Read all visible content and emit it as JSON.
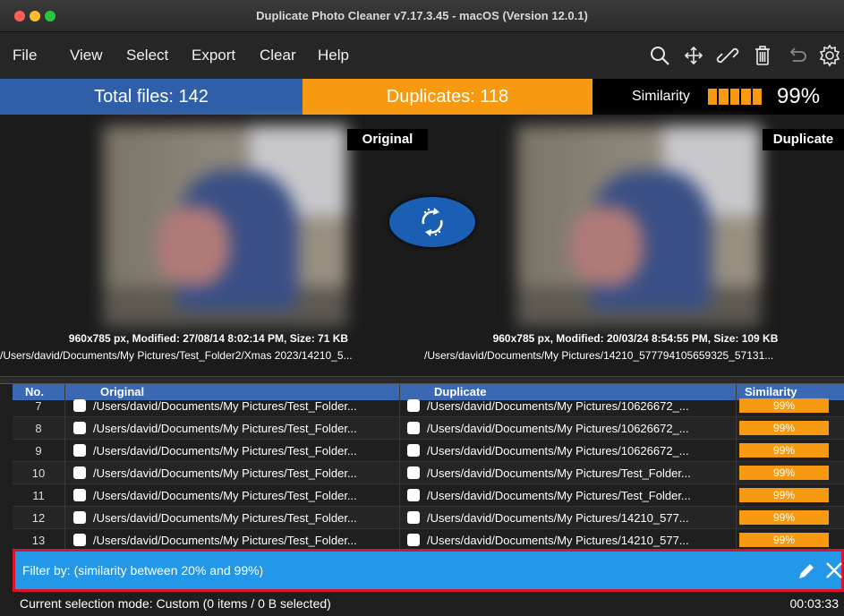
{
  "window": {
    "title": "Duplicate Photo Cleaner v7.17.3.45 - macOS (Version 12.0.1)"
  },
  "menu": {
    "items": [
      "File",
      "View",
      "Select",
      "Export",
      "Clear",
      "Help"
    ]
  },
  "toolbar": {
    "icons": [
      "search-icon",
      "move-icon",
      "link-icon",
      "trash-icon",
      "undo-icon",
      "gear-icon"
    ]
  },
  "stats": {
    "total_files": "Total files: 142",
    "duplicates": "Duplicates: 118",
    "similarity_label": "Similarity",
    "similarity_value": "99%",
    "similarity_bar_fraction": 1.0
  },
  "preview": {
    "original_tag": "Original",
    "duplicate_tag": "Duplicate",
    "original_meta": "960x785 px, Modified: 27/08/14 8:02:14 PM, Size: 71 KB",
    "duplicate_meta": "960x785 px, Modified: 20/03/24 8:54:55 PM, Size: 109 KB",
    "original_path": "/Users/david/Documents/My Pictures/Test_Folder2/Xmas 2023/14210_5...",
    "duplicate_path": "/Users/david/Documents/My Pictures/14210_577794105659325_57131..."
  },
  "table": {
    "headers": {
      "no": "No.",
      "original": "Original",
      "duplicate": "Duplicate",
      "similarity": "Similarity"
    },
    "rows": [
      {
        "no": "7",
        "original": "/Users/david/Documents/My Pictures/Test_Folder...",
        "duplicate": "/Users/david/Documents/My Pictures/10626672_...",
        "similarity": "99%"
      },
      {
        "no": "8",
        "original": "/Users/david/Documents/My Pictures/Test_Folder...",
        "duplicate": "/Users/david/Documents/My Pictures/10626672_...",
        "similarity": "99%"
      },
      {
        "no": "9",
        "original": "/Users/david/Documents/My Pictures/Test_Folder...",
        "duplicate": "/Users/david/Documents/My Pictures/10626672_...",
        "similarity": "99%"
      },
      {
        "no": "10",
        "original": "/Users/david/Documents/My Pictures/Test_Folder...",
        "duplicate": "/Users/david/Documents/My Pictures/Test_Folder...",
        "similarity": "99%"
      },
      {
        "no": "11",
        "original": "/Users/david/Documents/My Pictures/Test_Folder...",
        "duplicate": "/Users/david/Documents/My Pictures/Test_Folder...",
        "similarity": "99%"
      },
      {
        "no": "12",
        "original": "/Users/david/Documents/My Pictures/Test_Folder...",
        "duplicate": "/Users/david/Documents/My Pictures/14210_577...",
        "similarity": "99%"
      },
      {
        "no": "13",
        "original": "/Users/david/Documents/My Pictures/Test_Folder...",
        "duplicate": "/Users/david/Documents/My Pictures/14210_577...",
        "similarity": "99%"
      }
    ]
  },
  "filter": {
    "text": "Filter by: (similarity between 20% and 99%)"
  },
  "status": {
    "selection": "Current selection mode: Custom (0 items / 0 B selected)",
    "elapsed": "00:03:33"
  },
  "colors": {
    "accent_blue": "#2f5fa8",
    "accent_orange": "#f79a12",
    "filter_blue": "#2397e8",
    "highlight_red": "#d9142b"
  }
}
